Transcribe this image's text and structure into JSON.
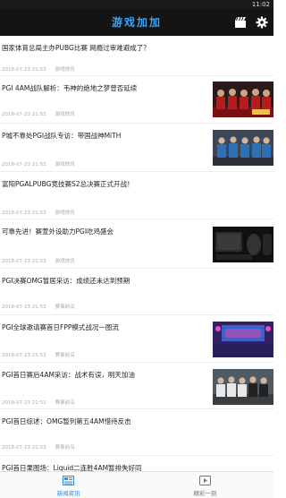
{
  "status": {
    "time": "11:02"
  },
  "header": {
    "title": "游戏加加"
  },
  "feed": [
    {
      "title": "国家体育总局主办PUBG比赛 网瘾过审难避成了？",
      "date": "2018-07-23 21:53",
      "source": "游戏快讯",
      "thumb": ""
    },
    {
      "title": "PGI 4AM战队解析：韦神的绝地之梦曾否延续",
      "date": "2018-07-23 21:53",
      "source": "游戏快讯",
      "thumb": "team-red"
    },
    {
      "title": "P城不靠处PGI战队专访：带国战神MiTH",
      "date": "2018-07-23 21:53",
      "source": "游戏快讯",
      "thumb": "team-blue"
    },
    {
      "title": "富阳PGALPUBG竞技赛S2总决赛正式开战！",
      "date": "2018-07-23 21:53",
      "source": "游戏快讯",
      "thumb": ""
    },
    {
      "title": "可靠先进！赛萱外设助力PGI吃鸡盛会",
      "date": "2018-07-23 21:53",
      "source": "游戏快讯",
      "thumb": "peripherals"
    },
    {
      "title": "PGI决赛OMG暂居采访：成绩还未达到预期",
      "date": "2018-07-23 21:53",
      "source": "赛事前沿",
      "thumb": ""
    },
    {
      "title": "PGI全球邀请赛首日FPP模式战况一图流",
      "date": "2018-07-23 21:53",
      "source": "赛事前沿",
      "thumb": "stage"
    },
    {
      "title": "PGI首日赛后4AM采访：战术有误，明天加油",
      "date": "2018-07-23 21:53",
      "source": "赛事前沿",
      "thumb": "team-mix"
    },
    {
      "title": "PGI首日综述：OMG暂列第五4AM惜待反击",
      "date": "2018-07-23 21:53",
      "source": "赛事前沿",
      "thumb": ""
    },
    {
      "title": "PGI首日果图场：Liquid二连胜4AM暂排失好同",
      "date": "",
      "source": "",
      "thumb": ""
    }
  ],
  "tabbar": {
    "news_label": "新闻资讯",
    "video_label": "精彩一刻"
  },
  "colors": {
    "accent": "#2b8fe0",
    "header_bg": "#141414",
    "title_blue": "#36a6ff"
  }
}
